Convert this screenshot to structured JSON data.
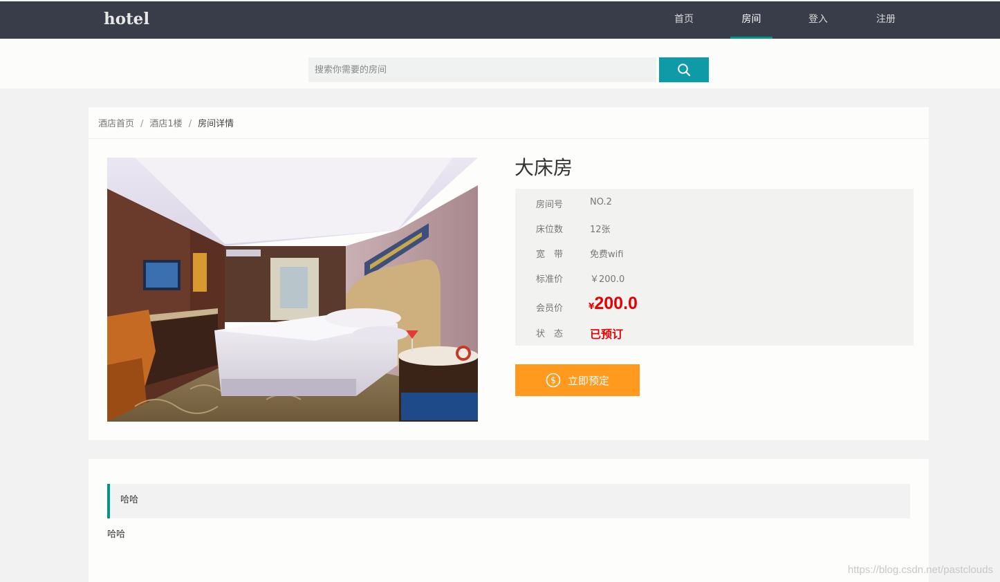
{
  "header": {
    "logo": "hotel",
    "nav": [
      {
        "label": "首页",
        "active": false
      },
      {
        "label": "房间",
        "active": true
      },
      {
        "label": "登入",
        "active": false
      },
      {
        "label": "注册",
        "active": false
      }
    ],
    "accent_color": "#009688"
  },
  "search": {
    "placeholder": "搜索你需要的房间",
    "button_icon": "search-icon"
  },
  "breadcrumb": {
    "items": [
      "酒店首页",
      "酒店1楼",
      "房间详情"
    ],
    "separator": "/"
  },
  "room": {
    "title": "大床房",
    "details": [
      {
        "label": "房间号",
        "value": "NO.2"
      },
      {
        "label": "床位数",
        "value": "12张"
      },
      {
        "label": "宽　带",
        "value": "免费wifi"
      },
      {
        "label": "标准价",
        "value": "￥200.0"
      }
    ],
    "member_price": {
      "label": "会员价",
      "currency": "¥",
      "value": "200.0"
    },
    "status": {
      "label": "状　态",
      "value": "已预订"
    },
    "book_button": {
      "label": "立即预定",
      "icon": "dollar-circle-icon"
    },
    "image_alt": "hotel-room-photo"
  },
  "description": {
    "quote": "哈哈",
    "text": "哈哈"
  },
  "watermark": "https://blog.csdn.net/pastclouds"
}
